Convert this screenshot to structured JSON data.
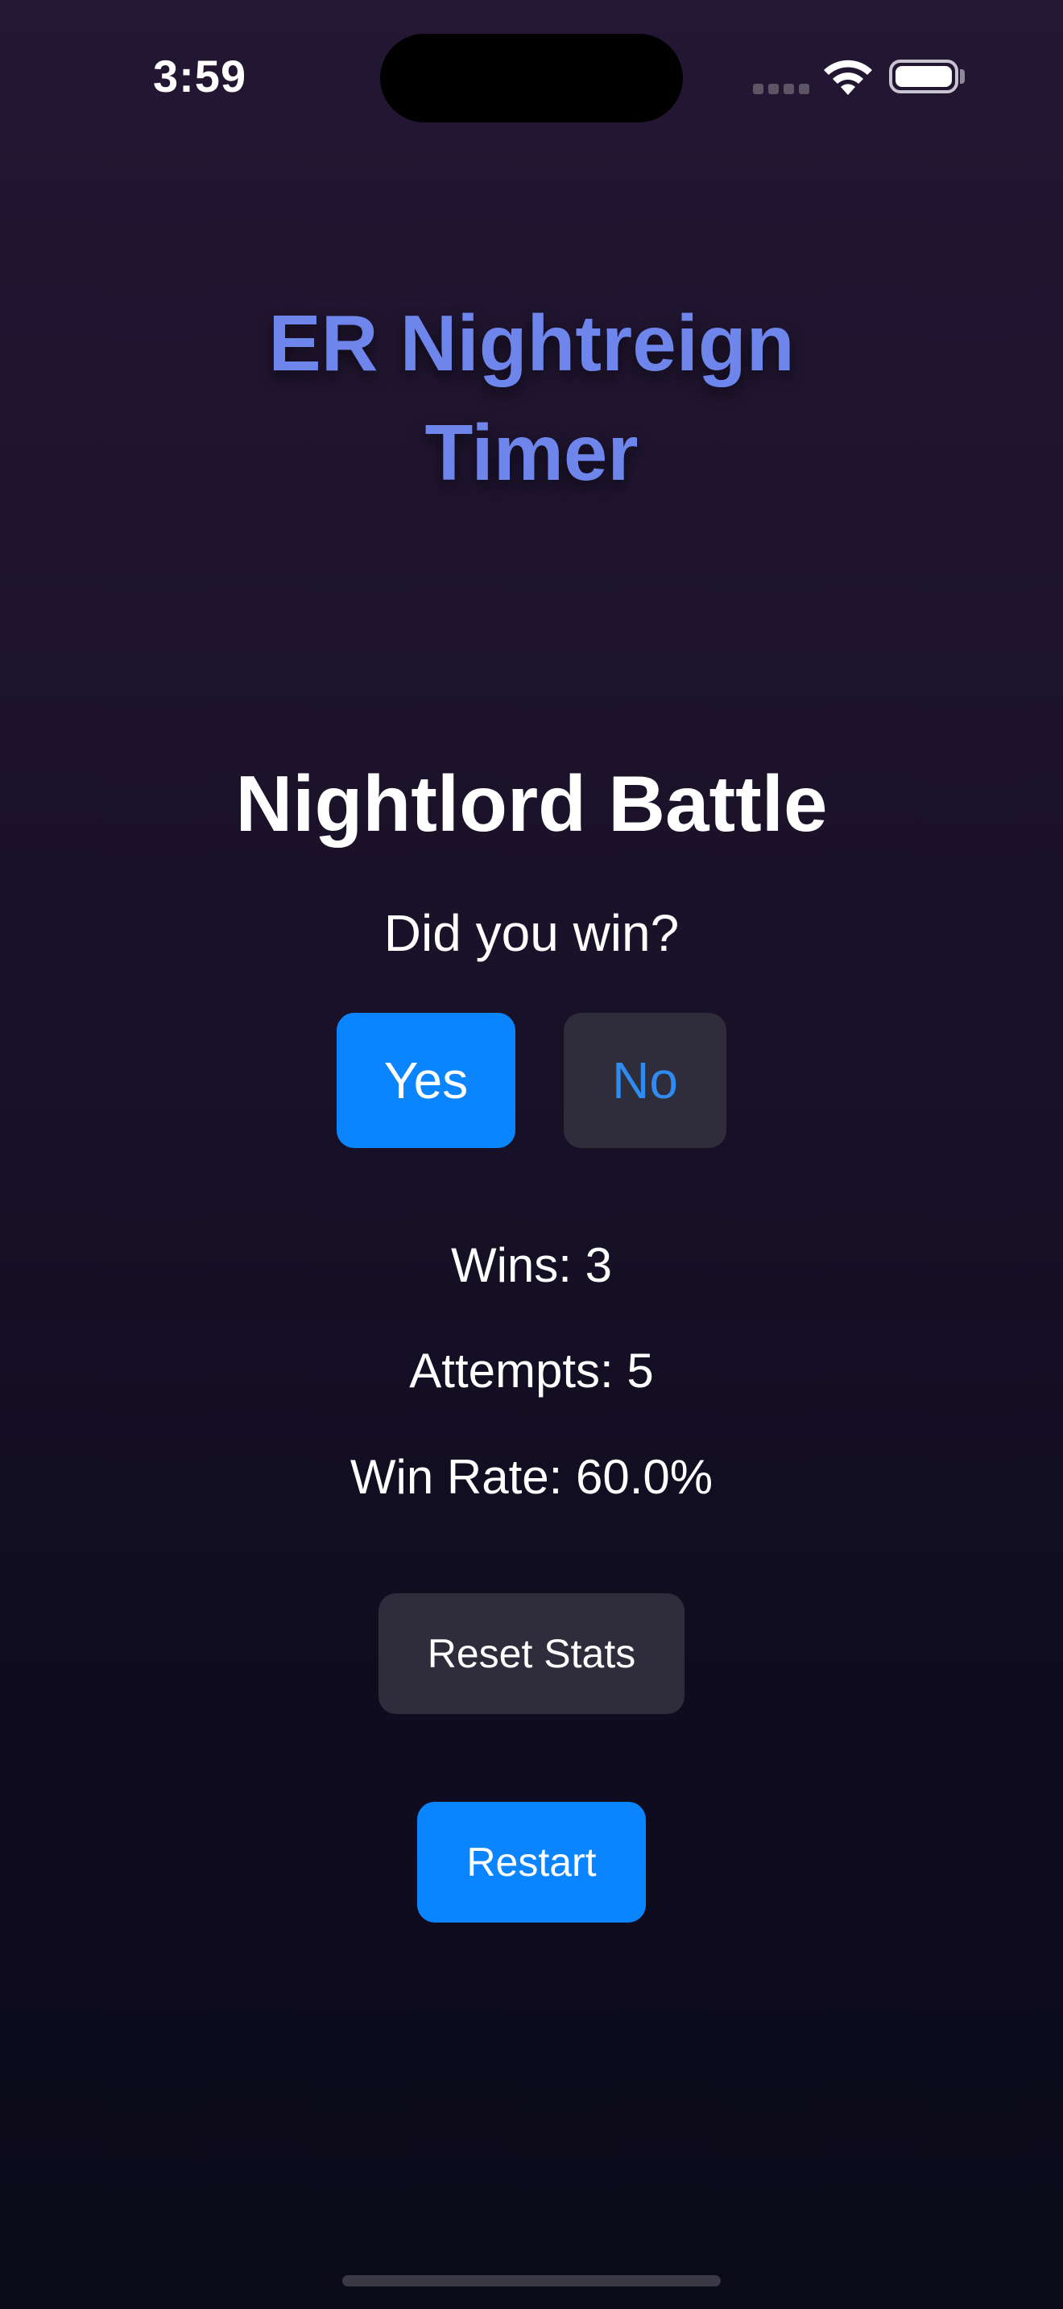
{
  "status_bar": {
    "time": "3:59",
    "icons": [
      "signal-icon",
      "wifi-icon",
      "battery-icon"
    ]
  },
  "app": {
    "title_line1": "ER Nightreign",
    "title_line2": "Timer"
  },
  "battle": {
    "title": "Nightlord Battle",
    "question": "Did you win?",
    "yes_label": "Yes",
    "no_label": "No"
  },
  "stats": {
    "wins": "Wins: 3",
    "attempts": "Attempts: 5",
    "win_rate": "Win Rate: 60.0%"
  },
  "actions": {
    "reset_label": "Reset Stats",
    "restart_label": "Restart"
  },
  "colors": {
    "accent": "#0a84ff",
    "title": "#6e86ec",
    "secondary_button": "#2f2c3b"
  }
}
